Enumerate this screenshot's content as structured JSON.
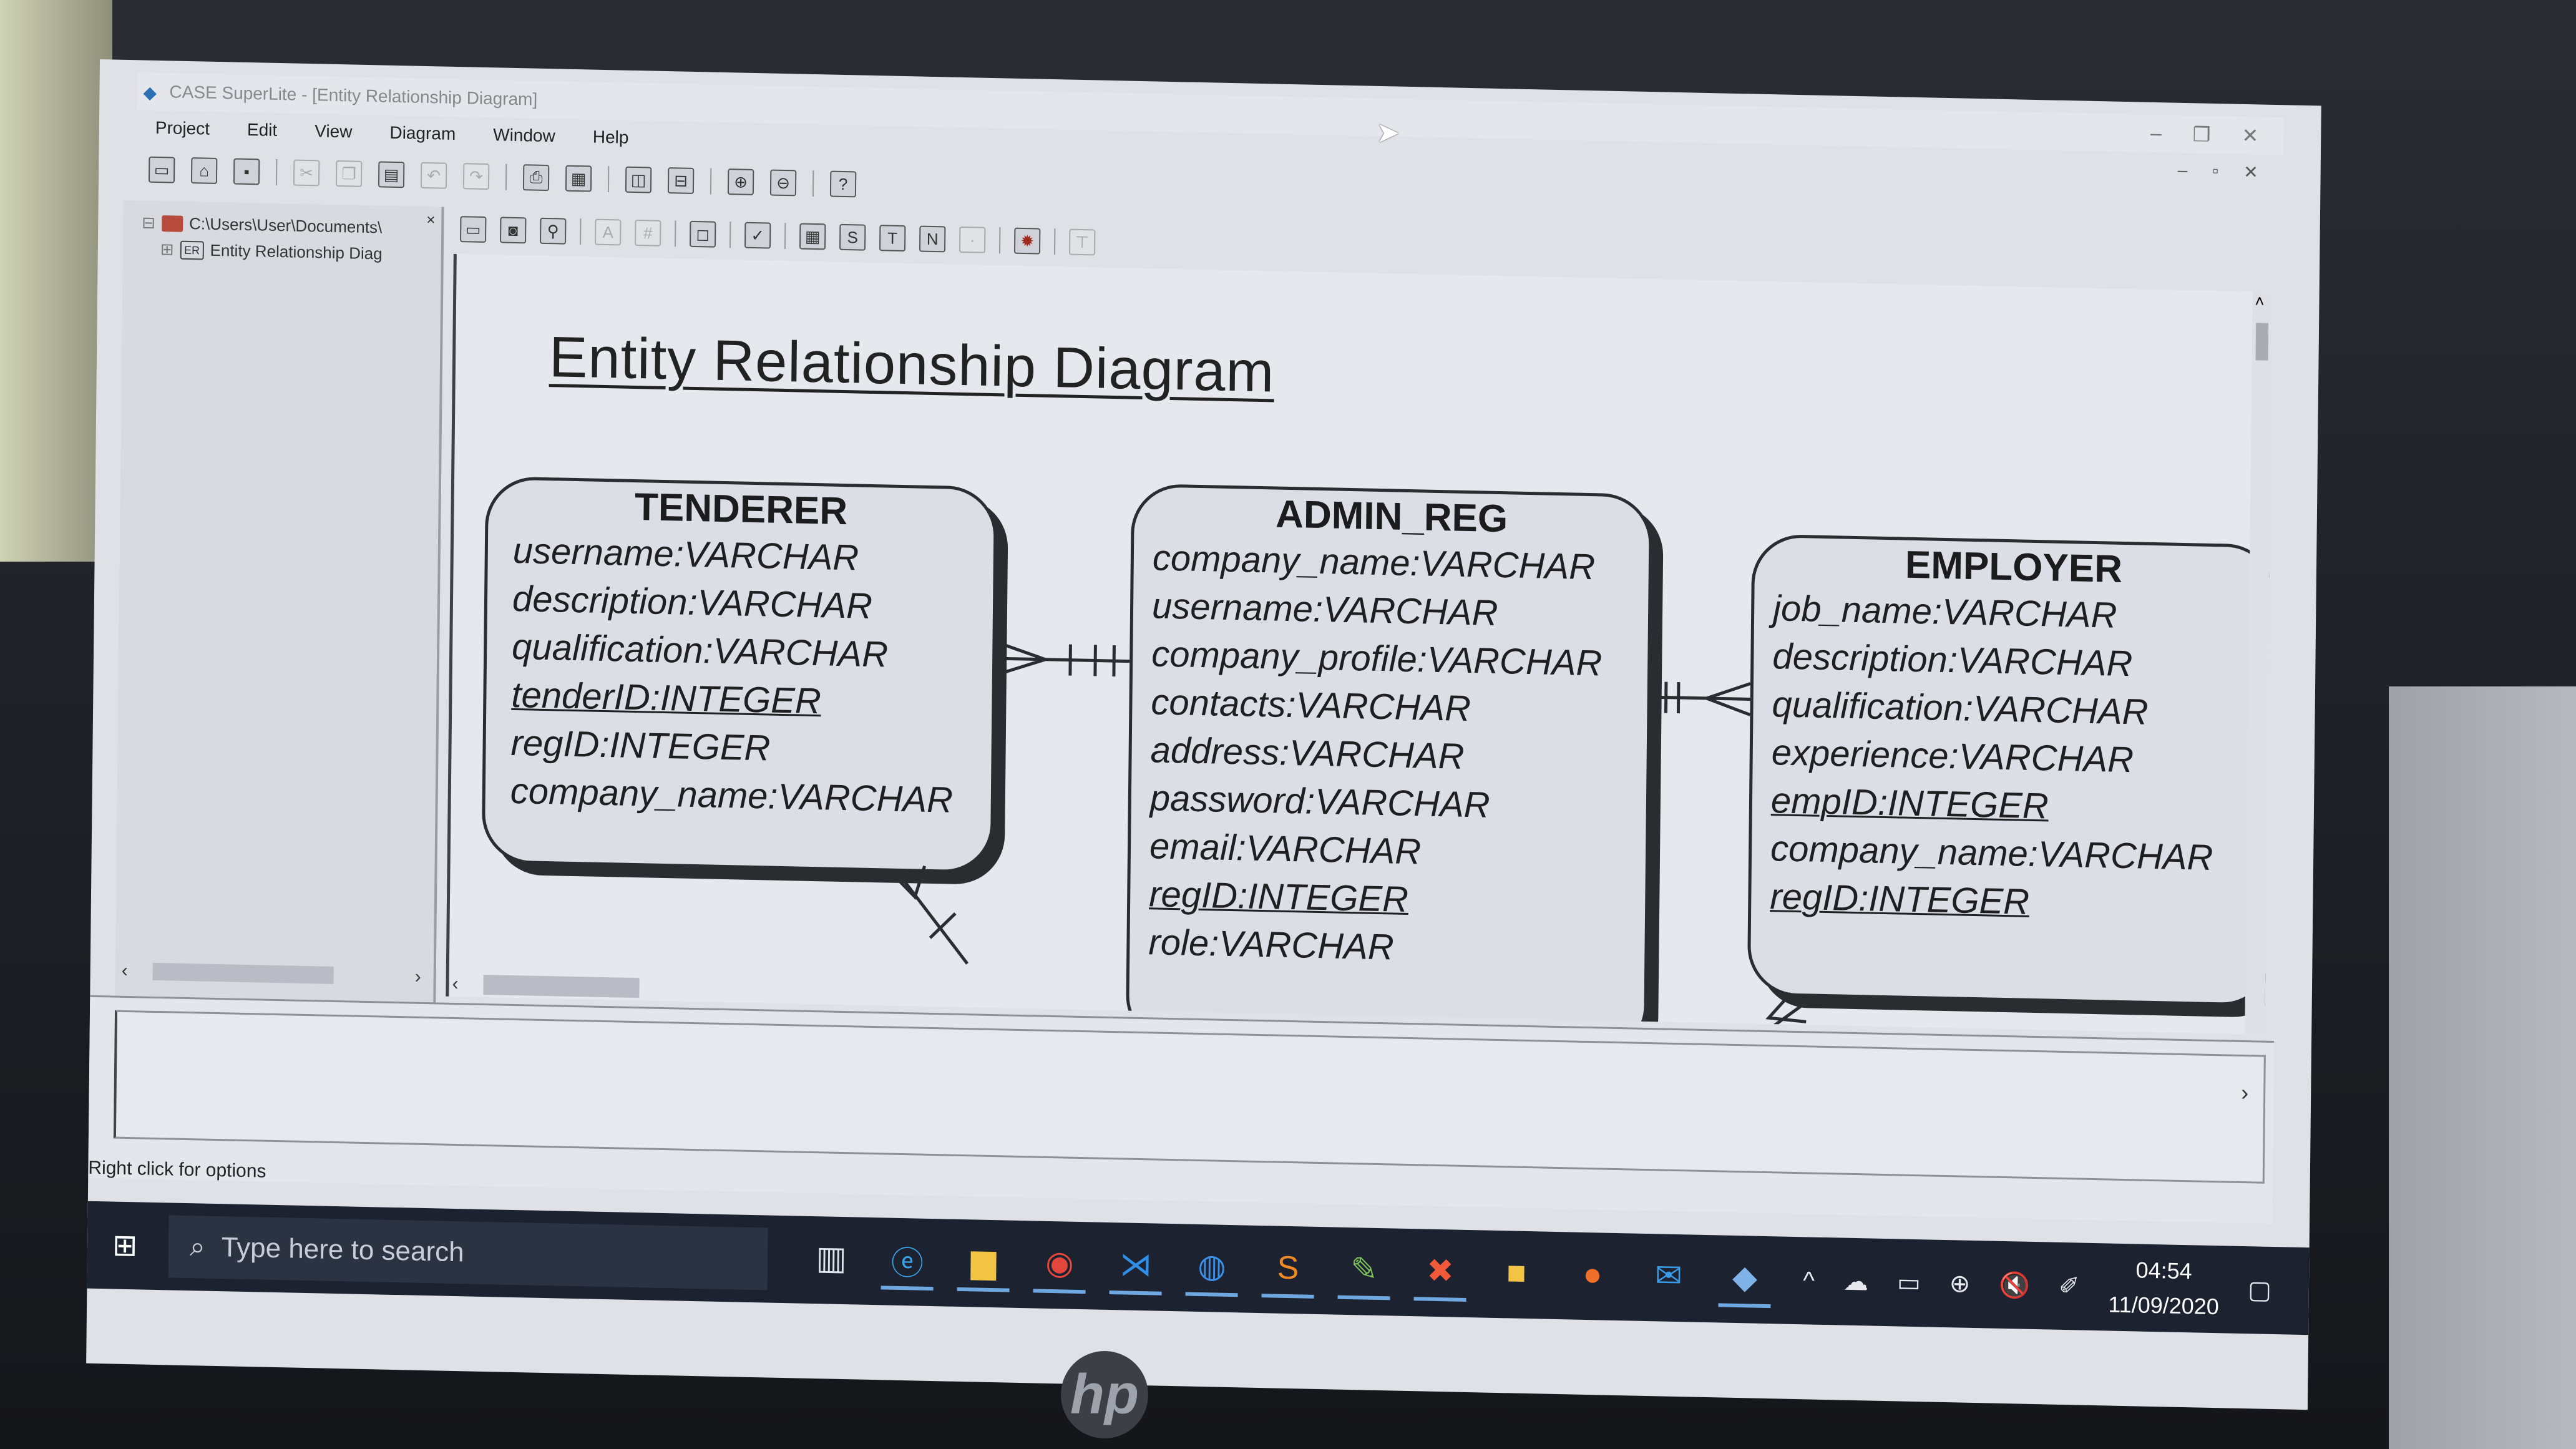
{
  "window": {
    "title": "CASE SuperLite - [Entity Relationship Diagram]",
    "controls": [
      "–",
      "❐",
      "✕"
    ]
  },
  "menu": [
    "Project",
    "Edit",
    "View",
    "Diagram",
    "Window",
    "Help"
  ],
  "doc_controls": [
    "–",
    "▫",
    "✕"
  ],
  "tree": {
    "root": "C:\\Users\\User\\Documents\\",
    "child": "Entity Relationship Diag"
  },
  "diagram": {
    "title": "Entity Relationship Diagram",
    "entities": [
      {
        "name": "TENDERER",
        "attributes": [
          {
            "text": "username:VARCHAR",
            "pk": false
          },
          {
            "text": "description:VARCHAR",
            "pk": false
          },
          {
            "text": "qualification:VARCHAR",
            "pk": false
          },
          {
            "text": "tenderID:INTEGER",
            "pk": true
          },
          {
            "text": "regID:INTEGER",
            "pk": false
          },
          {
            "text": "company_name:VARCHAR",
            "pk": false
          }
        ]
      },
      {
        "name": "ADMIN_REG",
        "attributes": [
          {
            "text": "company_name:VARCHAR",
            "pk": false
          },
          {
            "text": "username:VARCHAR",
            "pk": false
          },
          {
            "text": "company_profile:VARCHAR",
            "pk": false
          },
          {
            "text": "contacts:VARCHAR",
            "pk": false
          },
          {
            "text": "address:VARCHAR",
            "pk": false
          },
          {
            "text": "password:VARCHAR",
            "pk": false
          },
          {
            "text": "email:VARCHAR",
            "pk": false
          },
          {
            "text": "regID:INTEGER",
            "pk": true
          },
          {
            "text": "role:VARCHAR",
            "pk": false
          }
        ]
      },
      {
        "name": "EMPLOYER",
        "attributes": [
          {
            "text": "job_name:VARCHAR",
            "pk": false
          },
          {
            "text": "description:VARCHAR",
            "pk": false
          },
          {
            "text": "qualification:VARCHAR",
            "pk": false
          },
          {
            "text": "experience:VARCHAR",
            "pk": false
          },
          {
            "text": "empID:INTEGER",
            "pk": true
          },
          {
            "text": "company_name:VARCHAR",
            "pk": false
          },
          {
            "text": "regID:INTEGER",
            "pk": true
          }
        ]
      }
    ]
  },
  "status": "Right click for options",
  "taskbar": {
    "search_placeholder": "Type here to search",
    "time": "04:54",
    "date": "11/09/2020"
  },
  "brand": "hp"
}
